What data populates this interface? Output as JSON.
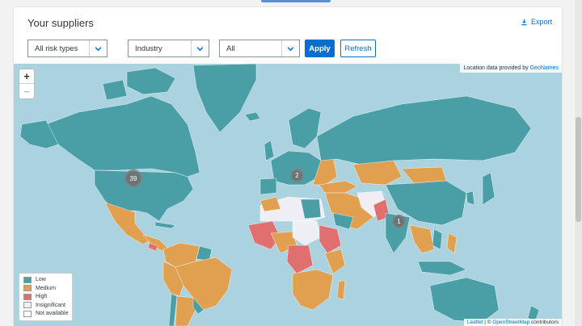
{
  "card": {
    "title": "Your suppliers",
    "export_label": "Export"
  },
  "filters": {
    "risk_type": "All risk types",
    "category": "Industry",
    "scope": "All",
    "apply_label": "Apply",
    "refresh_label": "Refresh"
  },
  "map": {
    "attribution_top_prefix": "Location data provided by",
    "attribution_top_link": "GeoNames",
    "attribution_bottom_link1": "Leaflet",
    "attribution_bottom_sep": " | © ",
    "attribution_bottom_link2": "OpenStreetMap",
    "attribution_bottom_suffix": " contributors",
    "zoom_in": "+",
    "zoom_out": "−",
    "clusters": [
      {
        "label": "39"
      },
      {
        "label": "2"
      },
      {
        "label": "1"
      }
    ]
  },
  "legend": {
    "items": [
      {
        "label": "Low",
        "color": "#4a9ea6"
      },
      {
        "label": "Medium",
        "color": "#e0a050"
      },
      {
        "label": "High",
        "color": "#e07070"
      },
      {
        "label": "Insignificant",
        "color": "#f0eef5"
      },
      {
        "label": "Not available",
        "color": "#ffffff"
      }
    ]
  },
  "colors": {
    "accent": "#0a6ed1",
    "ocean": "#aad3df",
    "low": "#4a9ea6",
    "medium": "#e0a050",
    "high": "#e07070",
    "insignificant": "#f0eef5"
  }
}
